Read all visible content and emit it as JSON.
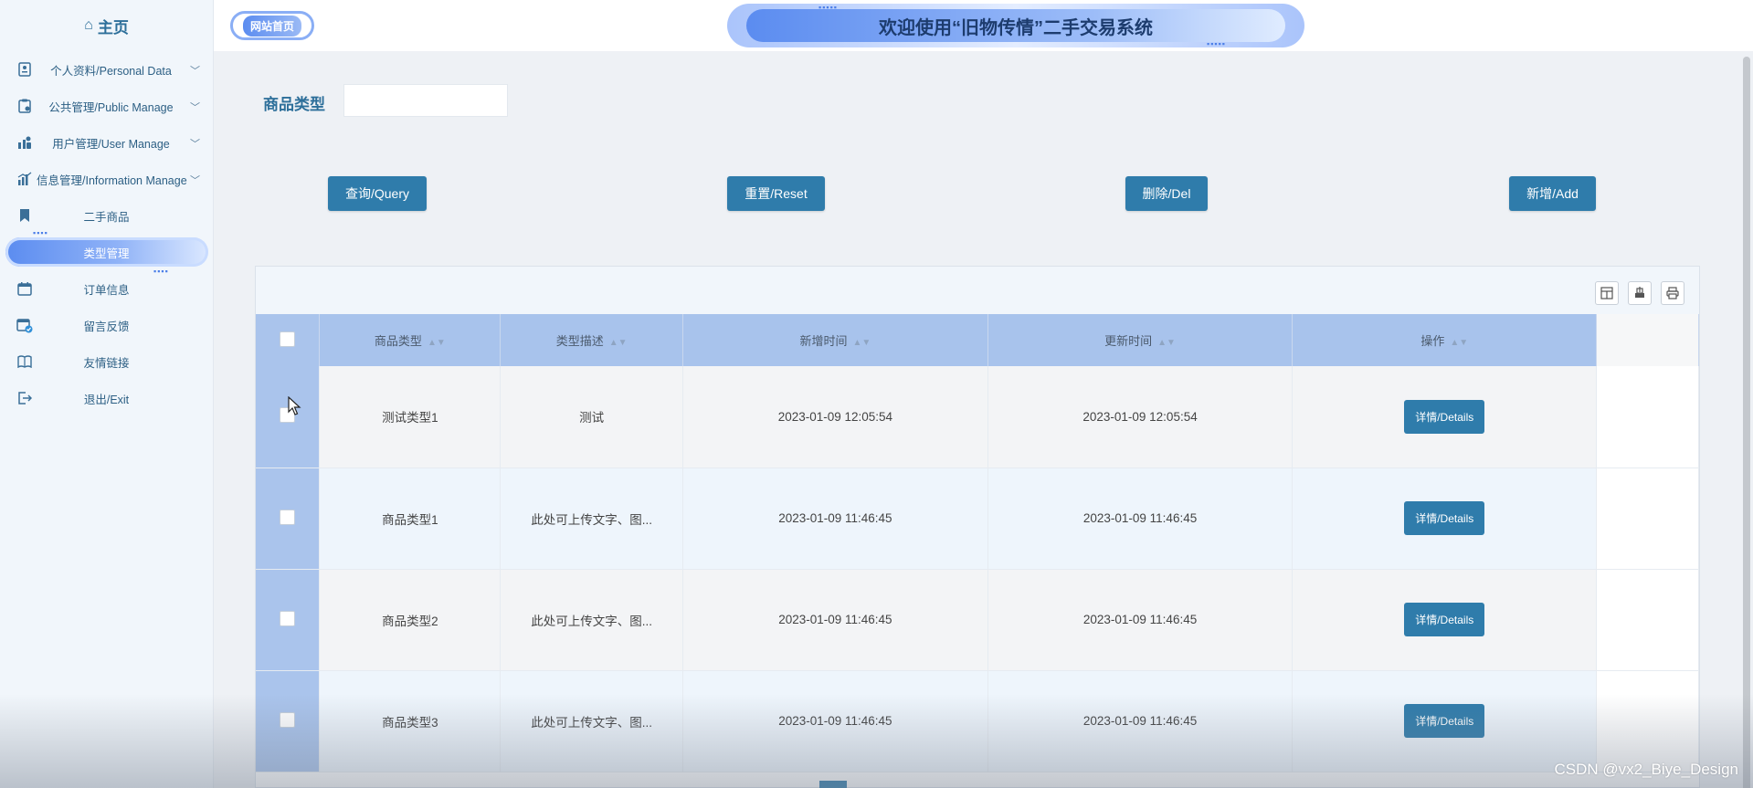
{
  "sidebar": {
    "home_label": "主页",
    "menu": [
      {
        "label": "个人资料/Personal Data",
        "icon": "id-card-icon",
        "chevron": true
      },
      {
        "label": "公共管理/Public Manage",
        "icon": "clipboard-icon",
        "chevron": true
      },
      {
        "label": "用户管理/User Manage",
        "icon": "user-chart-icon",
        "chevron": true
      },
      {
        "label": "信息管理/Information Manage",
        "icon": "bar-chart-icon",
        "chevron": true
      },
      {
        "label": "二手商品",
        "icon": "bookmark-icon",
        "chevron": false
      },
      {
        "label": "类型管理",
        "icon": "",
        "chevron": false,
        "active": true
      },
      {
        "label": "订单信息",
        "icon": "calendar-icon",
        "chevron": false
      },
      {
        "label": "留言反馈",
        "icon": "calendar-check-icon",
        "chevron": false
      },
      {
        "label": "友情链接",
        "icon": "book-icon",
        "chevron": false
      },
      {
        "label": "退出/Exit",
        "icon": "logout-icon",
        "chevron": false
      }
    ]
  },
  "header": {
    "site_home": "网站首页",
    "banner_title": "欢迎使用“旧物传情”二手交易系统"
  },
  "search": {
    "label": "商品类型",
    "value": ""
  },
  "actions": {
    "query": "查询/Query",
    "reset": "重置/Reset",
    "delete": "删除/Del",
    "add": "新增/Add"
  },
  "table": {
    "columns": [
      "商品类型",
      "类型描述",
      "新增时间",
      "更新时间",
      "操作"
    ],
    "rows": [
      {
        "type": "测试类型1",
        "desc": "测试",
        "created": "2023-01-09 12:05:54",
        "updated": "2023-01-09 12:05:54",
        "action": "详情/Details"
      },
      {
        "type": "商品类型1",
        "desc": "此处可上传文字、图...",
        "created": "2023-01-09 11:46:45",
        "updated": "2023-01-09 11:46:45",
        "action": "详情/Details"
      },
      {
        "type": "商品类型2",
        "desc": "此处可上传文字、图...",
        "created": "2023-01-09 11:46:45",
        "updated": "2023-01-09 11:46:45",
        "action": "详情/Details"
      },
      {
        "type": "商品类型3",
        "desc": "此处可上传文字、图...",
        "created": "2023-01-09 11:46:45",
        "updated": "2023-01-09 11:46:45",
        "action": "详情/Details"
      }
    ]
  },
  "toolbar_icons": [
    "columns-icon",
    "export-icon",
    "print-icon"
  ],
  "watermark": "CSDN @vx2_Biye_Design",
  "colors": {
    "primary_button": "#2f7cab",
    "header_row": "#a8c3ec",
    "accent_blue": "#5b8cf0"
  }
}
